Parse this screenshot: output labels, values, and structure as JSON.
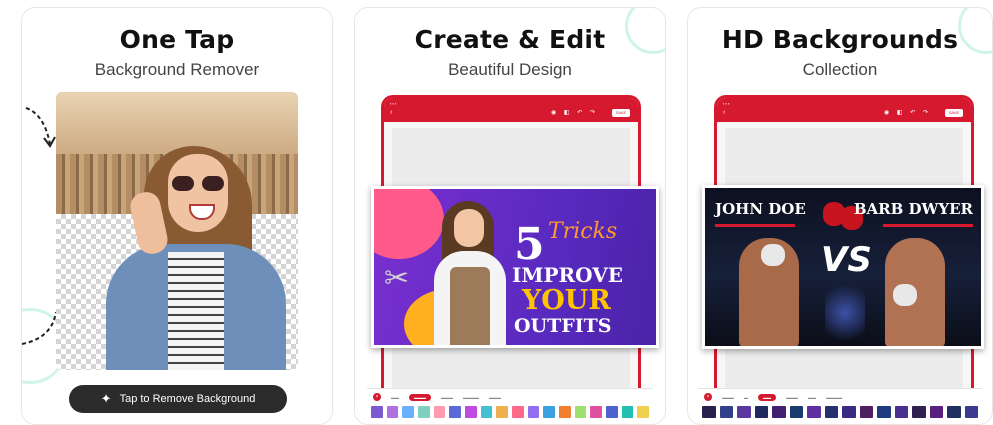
{
  "cards": [
    {
      "title": "One Tap",
      "subtitle": "Background Remover",
      "button_label": "Tap to Remove Background"
    },
    {
      "title": "Create & Edit",
      "subtitle": "Beautiful Design",
      "banner": {
        "number": "5",
        "script_word": "Tricks",
        "line1": "IMPROVE",
        "line2": "YOUR",
        "line3": "OUTFITS"
      }
    },
    {
      "title": "HD Backgrounds",
      "subtitle": "Collection",
      "banner": {
        "left_name": "JOHN DOE",
        "right_name": "BARB DWYER",
        "vs": "VS"
      }
    }
  ],
  "editor": {
    "save_label": "SAVE"
  },
  "colors": {
    "accent": "#d7192f",
    "pill_bg": "#2b2b2b"
  },
  "icons": {
    "sparkle": "sparkle-icon",
    "scissors": "scissors-icon",
    "close": "close-icon"
  },
  "swatches": [
    "#7a5ad0",
    "#b070e0",
    "#6ab0ff",
    "#80d0c0",
    "#ff9ab0",
    "#5a6ad8",
    "#c04ae0",
    "#40c0d0",
    "#f0b050",
    "#ff6a8a",
    "#9070f0",
    "#3aa0e0",
    "#f08030",
    "#a0e070",
    "#e050a0",
    "#5060d0",
    "#20c0b0",
    "#f0d050"
  ],
  "bg_swatches": [
    "#2a2050",
    "#30408a",
    "#5a3aa0",
    "#202a60",
    "#402070",
    "#1a3a70",
    "#6030a0",
    "#283070",
    "#3a2a80",
    "#502060",
    "#203a80",
    "#4a3090",
    "#302050",
    "#5a2080",
    "#203060",
    "#3a3a90"
  ]
}
